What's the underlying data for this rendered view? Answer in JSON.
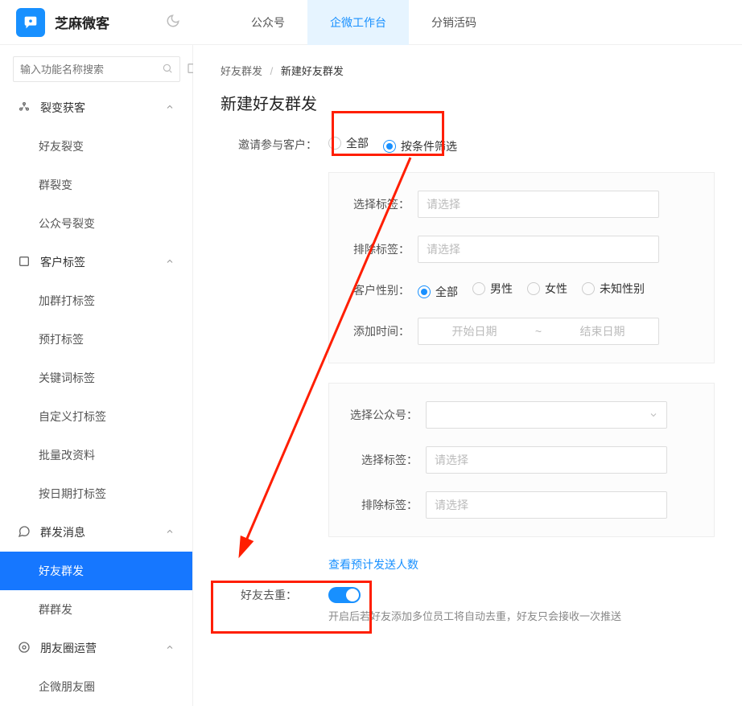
{
  "brand": "芝麻微客",
  "top_nav": [
    "公众号",
    "企微工作台",
    "分销活码"
  ],
  "top_nav_active_index": 1,
  "search_placeholder": "输入功能名称搜索",
  "sidebar": [
    {
      "type": "group",
      "icon": "fission",
      "label": "裂变获客",
      "collapsible": true,
      "expanded": true
    },
    {
      "type": "item",
      "label": "好友裂变"
    },
    {
      "type": "item",
      "label": "群裂变"
    },
    {
      "type": "item",
      "label": "公众号裂变"
    },
    {
      "type": "group",
      "icon": "tag",
      "label": "客户标签",
      "collapsible": true,
      "expanded": true
    },
    {
      "type": "item",
      "label": "加群打标签"
    },
    {
      "type": "item",
      "label": "预打标签"
    },
    {
      "type": "item",
      "label": "关键词标签"
    },
    {
      "type": "item",
      "label": "自定义打标签"
    },
    {
      "type": "item",
      "label": "批量改资料"
    },
    {
      "type": "item",
      "label": "按日期打标签"
    },
    {
      "type": "group",
      "icon": "msg",
      "label": "群发消息",
      "collapsible": true,
      "expanded": true
    },
    {
      "type": "item",
      "label": "好友群发",
      "active": true
    },
    {
      "type": "item",
      "label": "群群发"
    },
    {
      "type": "group",
      "icon": "moments",
      "label": "朋友圈运营",
      "collapsible": true,
      "expanded": true
    },
    {
      "type": "item",
      "label": "企微朋友圈"
    }
  ],
  "breadcrumb": {
    "root": "好友群发",
    "leaf": "新建好友群发"
  },
  "page_title": "新建好友群发",
  "invite_label": "邀请参与客户：",
  "invite_options": [
    "全部",
    "按条件筛选"
  ],
  "invite_selected_index": 1,
  "filter1": {
    "select_tag_label": "选择标签：",
    "exclude_tag_label": "排除标签：",
    "placeholder": "请选择",
    "gender_label": "客户性别：",
    "gender_options": [
      "全部",
      "男性",
      "女性",
      "未知性别"
    ],
    "gender_selected_index": 0,
    "addtime_label": "添加时间：",
    "start_placeholder": "开始日期",
    "end_placeholder": "结束日期"
  },
  "filter2": {
    "account_label": "选择公众号：",
    "select_tag_label": "选择标签：",
    "exclude_tag_label": "排除标签：",
    "placeholder": "请选择"
  },
  "preview_link": "查看预计发送人数",
  "dedupe": {
    "label": "好友去重：",
    "on": true
  },
  "dedupe_help": "开启后若好友添加多位员工将自动去重，好友只会接收一次推送"
}
